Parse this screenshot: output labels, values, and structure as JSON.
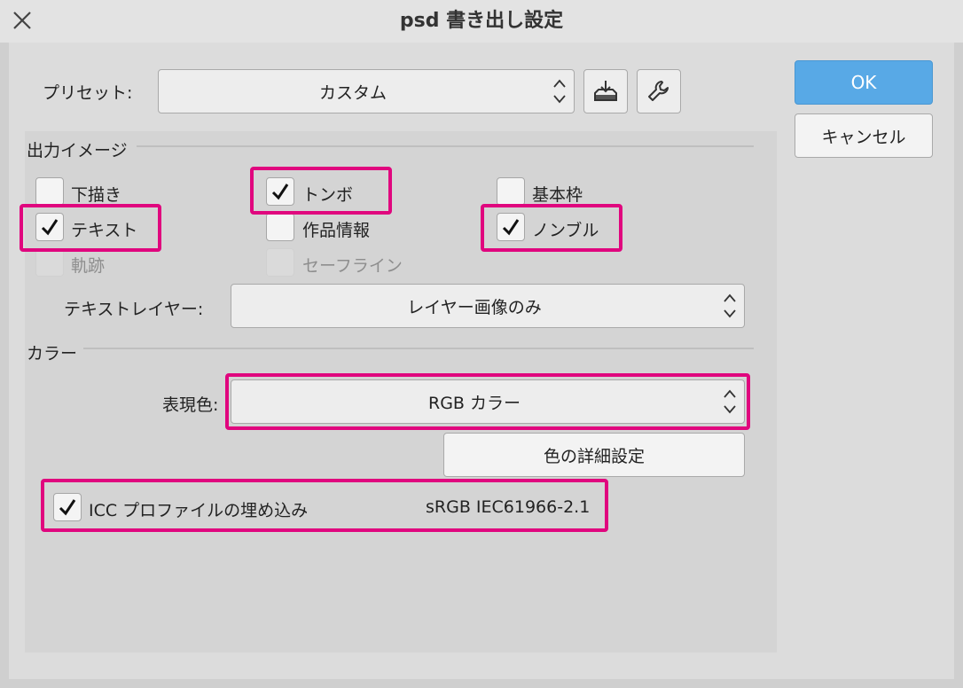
{
  "dialog": {
    "title": "psd 書き出し設定",
    "ok_label": "OK",
    "cancel_label": "キャンセル"
  },
  "preset": {
    "label": "プリセット:",
    "value": "カスタム",
    "save_icon": "save-preset-icon",
    "tool_icon": "wrench-icon"
  },
  "output_image": {
    "section_label": "出力イメージ",
    "options": {
      "draft": {
        "label": "下描き",
        "checked": false,
        "enabled": true
      },
      "crop_marks": {
        "label": "トンボ",
        "checked": true,
        "enabled": true
      },
      "basic_frame": {
        "label": "基本枠",
        "checked": false,
        "enabled": true
      },
      "text": {
        "label": "テキスト",
        "checked": true,
        "enabled": true
      },
      "work_info": {
        "label": "作品情報",
        "checked": false,
        "enabled": true
      },
      "page_number": {
        "label": "ノンブル",
        "checked": true,
        "enabled": true
      },
      "trace": {
        "label": "軌跡",
        "checked": false,
        "enabled": false
      },
      "safe_line": {
        "label": "セーフライン",
        "checked": false,
        "enabled": false
      }
    },
    "text_layer_label": "テキストレイヤー:",
    "text_layer_value": "レイヤー画像のみ"
  },
  "color": {
    "section_label": "カラー",
    "expression_label": "表現色:",
    "expression_value": "RGB カラー",
    "detail_button": "色の詳細設定",
    "icc_label": "ICC プロファイルの埋め込み",
    "icc_checked": true,
    "icc_profile": "sRGB IEC61966-2.1"
  },
  "colors": {
    "highlight": "#e0067e",
    "ok_button": "#58a9e6"
  }
}
